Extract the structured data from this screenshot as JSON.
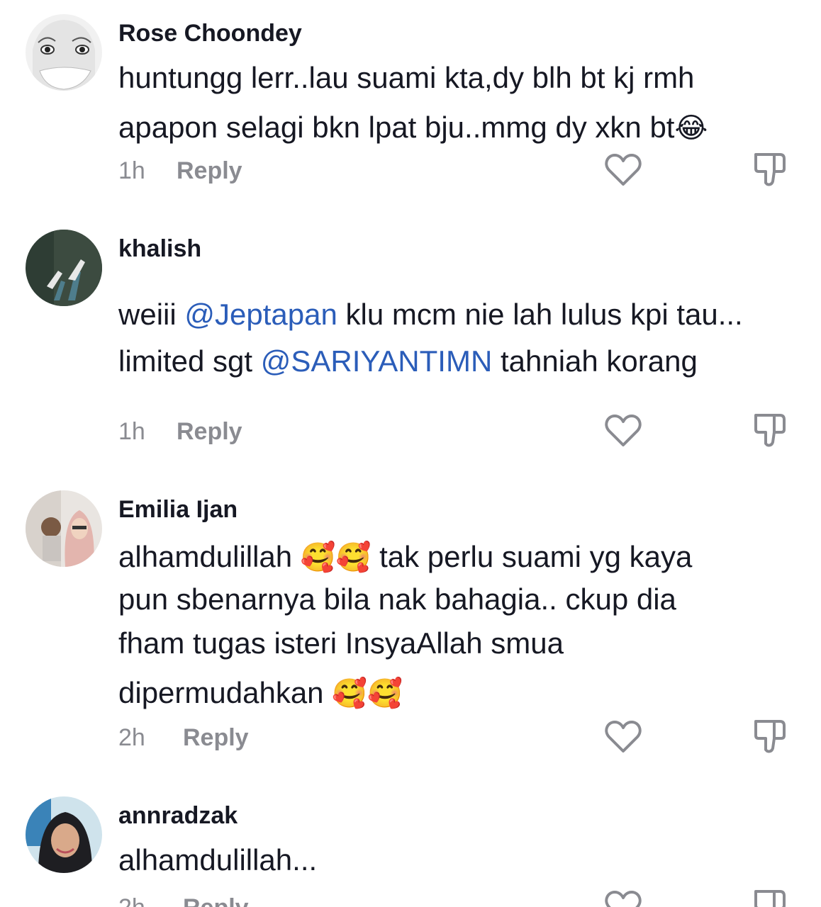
{
  "comments": [
    {
      "username": "Rose Choondey",
      "lines": [
        "huntungg lerr..lau suami kta,dy blh bt kj rmh",
        "apapon selagi bkn lpat bju..mmg dy xkn bt"
      ],
      "emoji_end": "😂",
      "time": "1h",
      "reply_label": "Reply"
    },
    {
      "username": "khalish",
      "line1_a": "weiii ",
      "line1_mention": "@Jeptapan",
      "line1_b": " klu mcm nie lah lulus kpi tau...",
      "line2_a": "limited sgt ",
      "line2_mention": "@SARIYANTIMN",
      "line2_b": " tahniah korang",
      "time": "1h",
      "reply_label": "Reply"
    },
    {
      "username": "Emilia Ijan",
      "line1_a": "alhamdulillah ",
      "line1_emoji": "🥰🥰",
      "line1_b": " tak perlu suami yg kaya",
      "line2": "pun sbenarnya bila nak bahagia.. ckup dia",
      "line3": "fham tugas isteri InsyaAllah smua",
      "line4_a": "dipermudahkan ",
      "line4_emoji": "🥰🥰",
      "time": "2h",
      "reply_label": "Reply"
    },
    {
      "username": "annradzak",
      "line1": "alhamdulillah...",
      "time": "2h",
      "reply_label": "Reply"
    }
  ],
  "colors": {
    "text": "#161823",
    "muted": "#8a8b91",
    "mention": "#2b5db9"
  }
}
